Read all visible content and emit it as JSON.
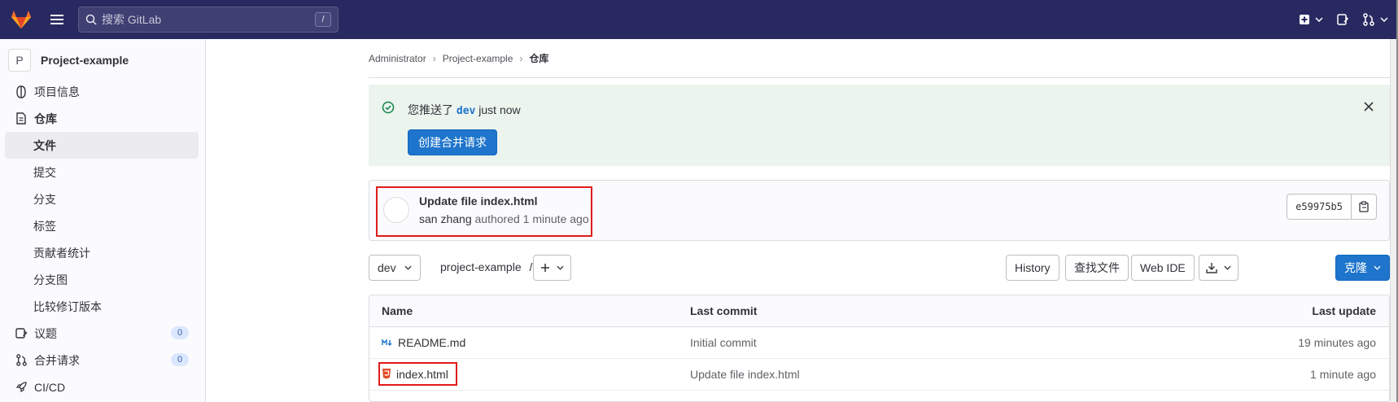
{
  "topbar": {
    "search_placeholder": "搜索 GitLab",
    "search_shortcut": "/",
    "colors": {
      "bg": "#292961",
      "logo_orange": "#fc6d26"
    }
  },
  "sidebar": {
    "project_initial": "P",
    "project_name": "Project-example",
    "items": [
      {
        "label": "项目信息",
        "icon": "info-icon"
      },
      {
        "label": "仓库",
        "icon": "document-icon"
      },
      {
        "label": "文件",
        "active": true
      },
      {
        "label": "提交"
      },
      {
        "label": "分支"
      },
      {
        "label": "标签"
      },
      {
        "label": "贡献者统计"
      },
      {
        "label": "分支图"
      },
      {
        "label": "比较修订版本"
      },
      {
        "label": "议题",
        "icon": "issues-icon",
        "badge": "0"
      },
      {
        "label": "合并请求",
        "icon": "merge-request-icon",
        "badge": "0"
      },
      {
        "label": "CI/CD",
        "icon": "rocket-icon"
      }
    ]
  },
  "breadcrumb": {
    "items": [
      "Administrator",
      "Project-example",
      "仓库"
    ]
  },
  "alert": {
    "prefix": "您推送了",
    "branch": "dev",
    "suffix": "just now",
    "button": "创建合并请求"
  },
  "commit": {
    "title": "Update file index.html",
    "author": "san zhang",
    "meta": "authored 1 minute ago",
    "sha": "e59975b5"
  },
  "toolbar": {
    "branch": "dev",
    "path": "project-example",
    "path_sep": "/",
    "history": "History",
    "find_file": "查找文件",
    "web_ide": "Web IDE",
    "clone": "克隆"
  },
  "table": {
    "headers": {
      "name": "Name",
      "last_commit": "Last commit",
      "last_update": "Last update"
    },
    "rows": [
      {
        "name": "README.md",
        "icon": "markdown-icon",
        "commit": "Initial commit",
        "update": "19 minutes ago"
      },
      {
        "name": "index.html",
        "icon": "html5-icon",
        "commit": "Update file index.html",
        "update": "1 minute ago"
      }
    ]
  }
}
